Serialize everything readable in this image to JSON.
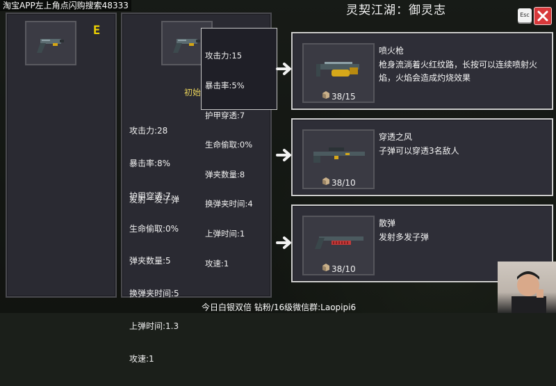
{
  "banner": "淘宝APP左上角点闪购搜索48333",
  "title": "灵契江湖：御灵志",
  "esc_label": "Esc",
  "left_panel": {
    "key_hint": "E"
  },
  "mid_panel": {
    "initial_label": "初始",
    "stats": [
      "攻击力:28",
      "暴击率:8%",
      "护甲穿透:7",
      "生命偷取:0%",
      "弹夹数量:5",
      "换弹夹时间:5",
      "上弹时间:1.3",
      "攻速:1"
    ],
    "description": "发射一发子弹"
  },
  "tooltip": {
    "stats": [
      "攻击力:15",
      "暴击率:5%",
      "护甲穿透:7",
      "生命偷取:0%",
      "弹夹数量:8",
      "换弹夹时间:4",
      "上弹时间:1",
      "攻速:1"
    ]
  },
  "cards": [
    {
      "name": "喷火枪",
      "description": "枪身流淌着火红纹路，长按可以连续喷射火焰，火焰会造成灼烧效果",
      "count": "38/15"
    },
    {
      "name": "穿透之风",
      "description": "子弹可以穿透3名敌人",
      "count": "38/10"
    },
    {
      "name": "散弹",
      "description": "发射多发子弹",
      "count": "38/10"
    }
  ],
  "bottom_text": "今日白银双倍 钻粉/16级微信群:Laopipi6",
  "colors": {
    "accent_yellow": "#f2d500",
    "close_red": "#d8393b",
    "panel_bg": "#2c2c35"
  }
}
